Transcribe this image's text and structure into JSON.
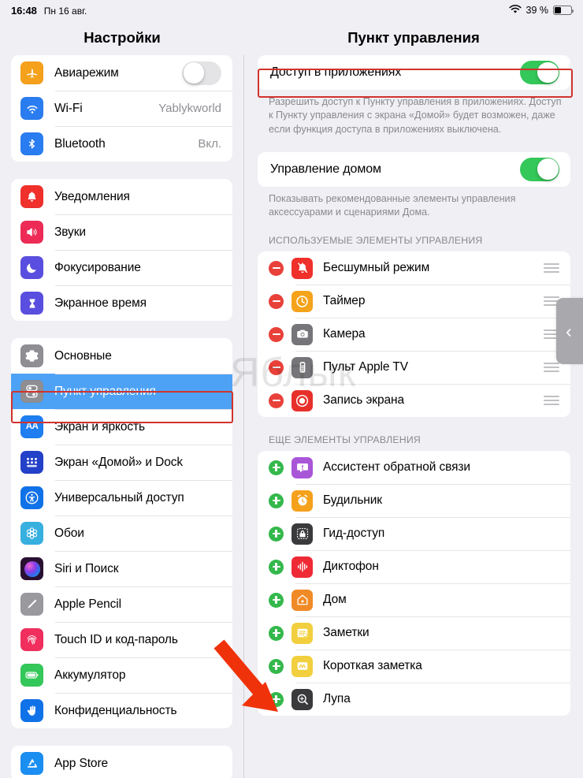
{
  "status_bar": {
    "time": "16:48",
    "date": "Пн 16 авг.",
    "wifi_icon": "wifi-icon",
    "battery_percent": "39 %",
    "battery_level": 39
  },
  "sidebar": {
    "title": "Настройки",
    "groups": [
      {
        "items": [
          {
            "label": "Авиарежим",
            "icon": "airplane-icon",
            "icon_color": "#f5a11b",
            "control": "toggle",
            "toggle_on": false
          },
          {
            "label": "Wi-Fi",
            "icon": "wifi-icon",
            "icon_color": "#2a7df0",
            "value": "Yablykworld"
          },
          {
            "label": "Bluetooth",
            "icon": "bluetooth-icon",
            "icon_color": "#2a7df0",
            "value": "Вкл."
          }
        ]
      },
      {
        "items": [
          {
            "label": "Уведомления",
            "icon": "bell-icon",
            "icon_color": "#f0302b"
          },
          {
            "label": "Звуки",
            "icon": "speaker-icon",
            "icon_color": "#ee2b56"
          },
          {
            "label": "Фокусирование",
            "icon": "moon-icon",
            "icon_color": "#5a4ee0"
          },
          {
            "label": "Экранное время",
            "icon": "hourglass-icon",
            "icon_color": "#5a4ee0"
          }
        ]
      },
      {
        "items": [
          {
            "label": "Основные",
            "icon": "gear-icon",
            "icon_color": "#8e8e93"
          },
          {
            "label": "Пункт управления",
            "icon": "control-center-icon",
            "icon_color": "#8e8e93",
            "selected": true
          },
          {
            "label": "Экран и яркость",
            "icon": "text-size-icon",
            "icon_color": "#1f7ef0"
          },
          {
            "label": "Экран «Домой» и Dock",
            "icon": "home-screen-icon",
            "icon_color": "#2340c8"
          },
          {
            "label": "Универсальный доступ",
            "icon": "accessibility-icon",
            "icon_color": "#1072e8"
          },
          {
            "label": "Обои",
            "icon": "wallpaper-icon",
            "icon_color": "#37b0e0"
          },
          {
            "label": "Siri и Поиск",
            "icon": "siri-icon",
            "icon_color": "#2a1030"
          },
          {
            "label": "Apple Pencil",
            "icon": "pencil-icon",
            "icon_color": "#9a9a9e"
          },
          {
            "label": "Touch ID и код-пароль",
            "icon": "fingerprint-icon",
            "icon_color": "#f02f5e"
          },
          {
            "label": "Аккумулятор",
            "icon": "battery-icon",
            "icon_color": "#34c759"
          },
          {
            "label": "Конфиденциальность",
            "icon": "hand-icon",
            "icon_color": "#1072e8"
          }
        ]
      },
      {
        "items": [
          {
            "label": "App Store",
            "icon": "app-store-icon",
            "icon_color": "#1b8ef2"
          }
        ]
      }
    ]
  },
  "detail": {
    "title": "Пункт управления",
    "settings": [
      {
        "label": "Доступ в приложениях",
        "toggle_on": true,
        "footer": "Разрешить доступ к Пункту управления в приложениях. Доступ к Пункту управления с экрана «Домой» будет возможен, даже если функция доступа в приложениях выключена."
      },
      {
        "label": "Управление домом",
        "toggle_on": true,
        "footer": "Показывать рекомендованные элементы управления аксессуарами и сценариями Дома."
      }
    ],
    "included_section": {
      "header": "ИСПОЛЬЗУЕМЫЕ ЭЛЕМЕНТЫ УПРАВЛЕНИЯ",
      "items": [
        {
          "label": "Бесшумный режим",
          "icon": "bell-slash-icon",
          "icon_color": "#f0302b",
          "action": "remove"
        },
        {
          "label": "Таймер",
          "icon": "timer-icon",
          "icon_color": "#f5a31b",
          "action": "remove"
        },
        {
          "label": "Камера",
          "icon": "camera-icon",
          "icon_color": "#76767a",
          "action": "remove"
        },
        {
          "label": "Пульт Apple TV",
          "icon": "apple-tv-remote-icon",
          "icon_color": "#76767a",
          "action": "remove"
        },
        {
          "label": "Запись экрана",
          "icon": "screen-record-icon",
          "icon_color": "#e8302b",
          "action": "remove"
        }
      ]
    },
    "more_section": {
      "header": "ЕЩЕ ЭЛЕМЕНТЫ УПРАВЛЕНИЯ",
      "items": [
        {
          "label": "Ассистент обратной связи",
          "icon": "feedback-assistant-icon",
          "icon_color": "#a855d8",
          "action": "add"
        },
        {
          "label": "Будильник",
          "icon": "alarm-icon",
          "icon_color": "#f5a11b",
          "action": "add"
        },
        {
          "label": "Гид-доступ",
          "icon": "guided-access-icon",
          "icon_color": "#3a3a3c",
          "action": "add"
        },
        {
          "label": "Диктофон",
          "icon": "voice-memos-icon",
          "icon_color": "#ee2a35",
          "action": "add"
        },
        {
          "label": "Дом",
          "icon": "home-icon",
          "icon_color": "#f08a26",
          "action": "add"
        },
        {
          "label": "Заметки",
          "icon": "notes-icon",
          "icon_color": "#f2cf3e",
          "action": "add"
        },
        {
          "label": "Короткая заметка",
          "icon": "quick-note-icon",
          "icon_color": "#f2cf3e",
          "action": "add"
        },
        {
          "label": "Лупа",
          "icon": "magnifier-icon",
          "icon_color": "#3a3a3c",
          "action": "add"
        }
      ]
    },
    "slideover_tab_icon": "chevron-left-icon"
  },
  "annotations": {
    "highlight_color": "#d2322d",
    "arrow_color": "#f0320a",
    "watermark_text": "Яблык"
  }
}
